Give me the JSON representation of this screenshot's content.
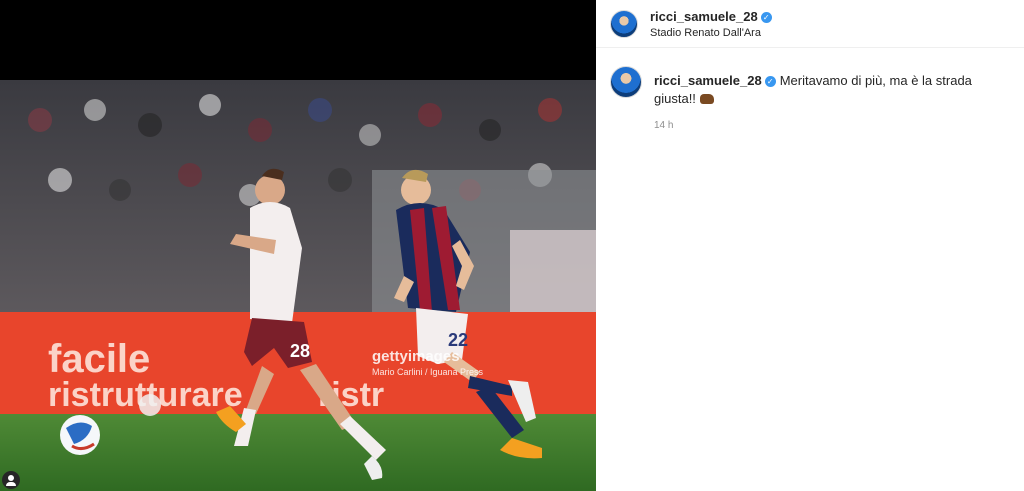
{
  "post": {
    "username": "ricci_samuele_28",
    "location": "Stadio Renato Dall'Ara",
    "caption": "Meritavamo di più, ma è la strada giusta!!",
    "time": "14 h"
  },
  "photo": {
    "ad_line1": "facile",
    "ad_line2": "ristrutturare",
    "ad_line3": "ristr",
    "watermark": "gettyimages",
    "credit": "Mario Carlini / Iguana Press",
    "shirt_left": "28",
    "shirt_right": "22"
  },
  "colors": {
    "verified": "#3897f0",
    "torino": "#7b1f2a",
    "bologna_blue": "#1a2b5c",
    "bologna_red": "#9e1b32",
    "board": "#e8452c",
    "pitch": "#3d7a2a"
  },
  "icons": {
    "verified": "verified-badge-icon",
    "tag": "user-tag-icon",
    "bear": "bear-emoji-icon"
  }
}
